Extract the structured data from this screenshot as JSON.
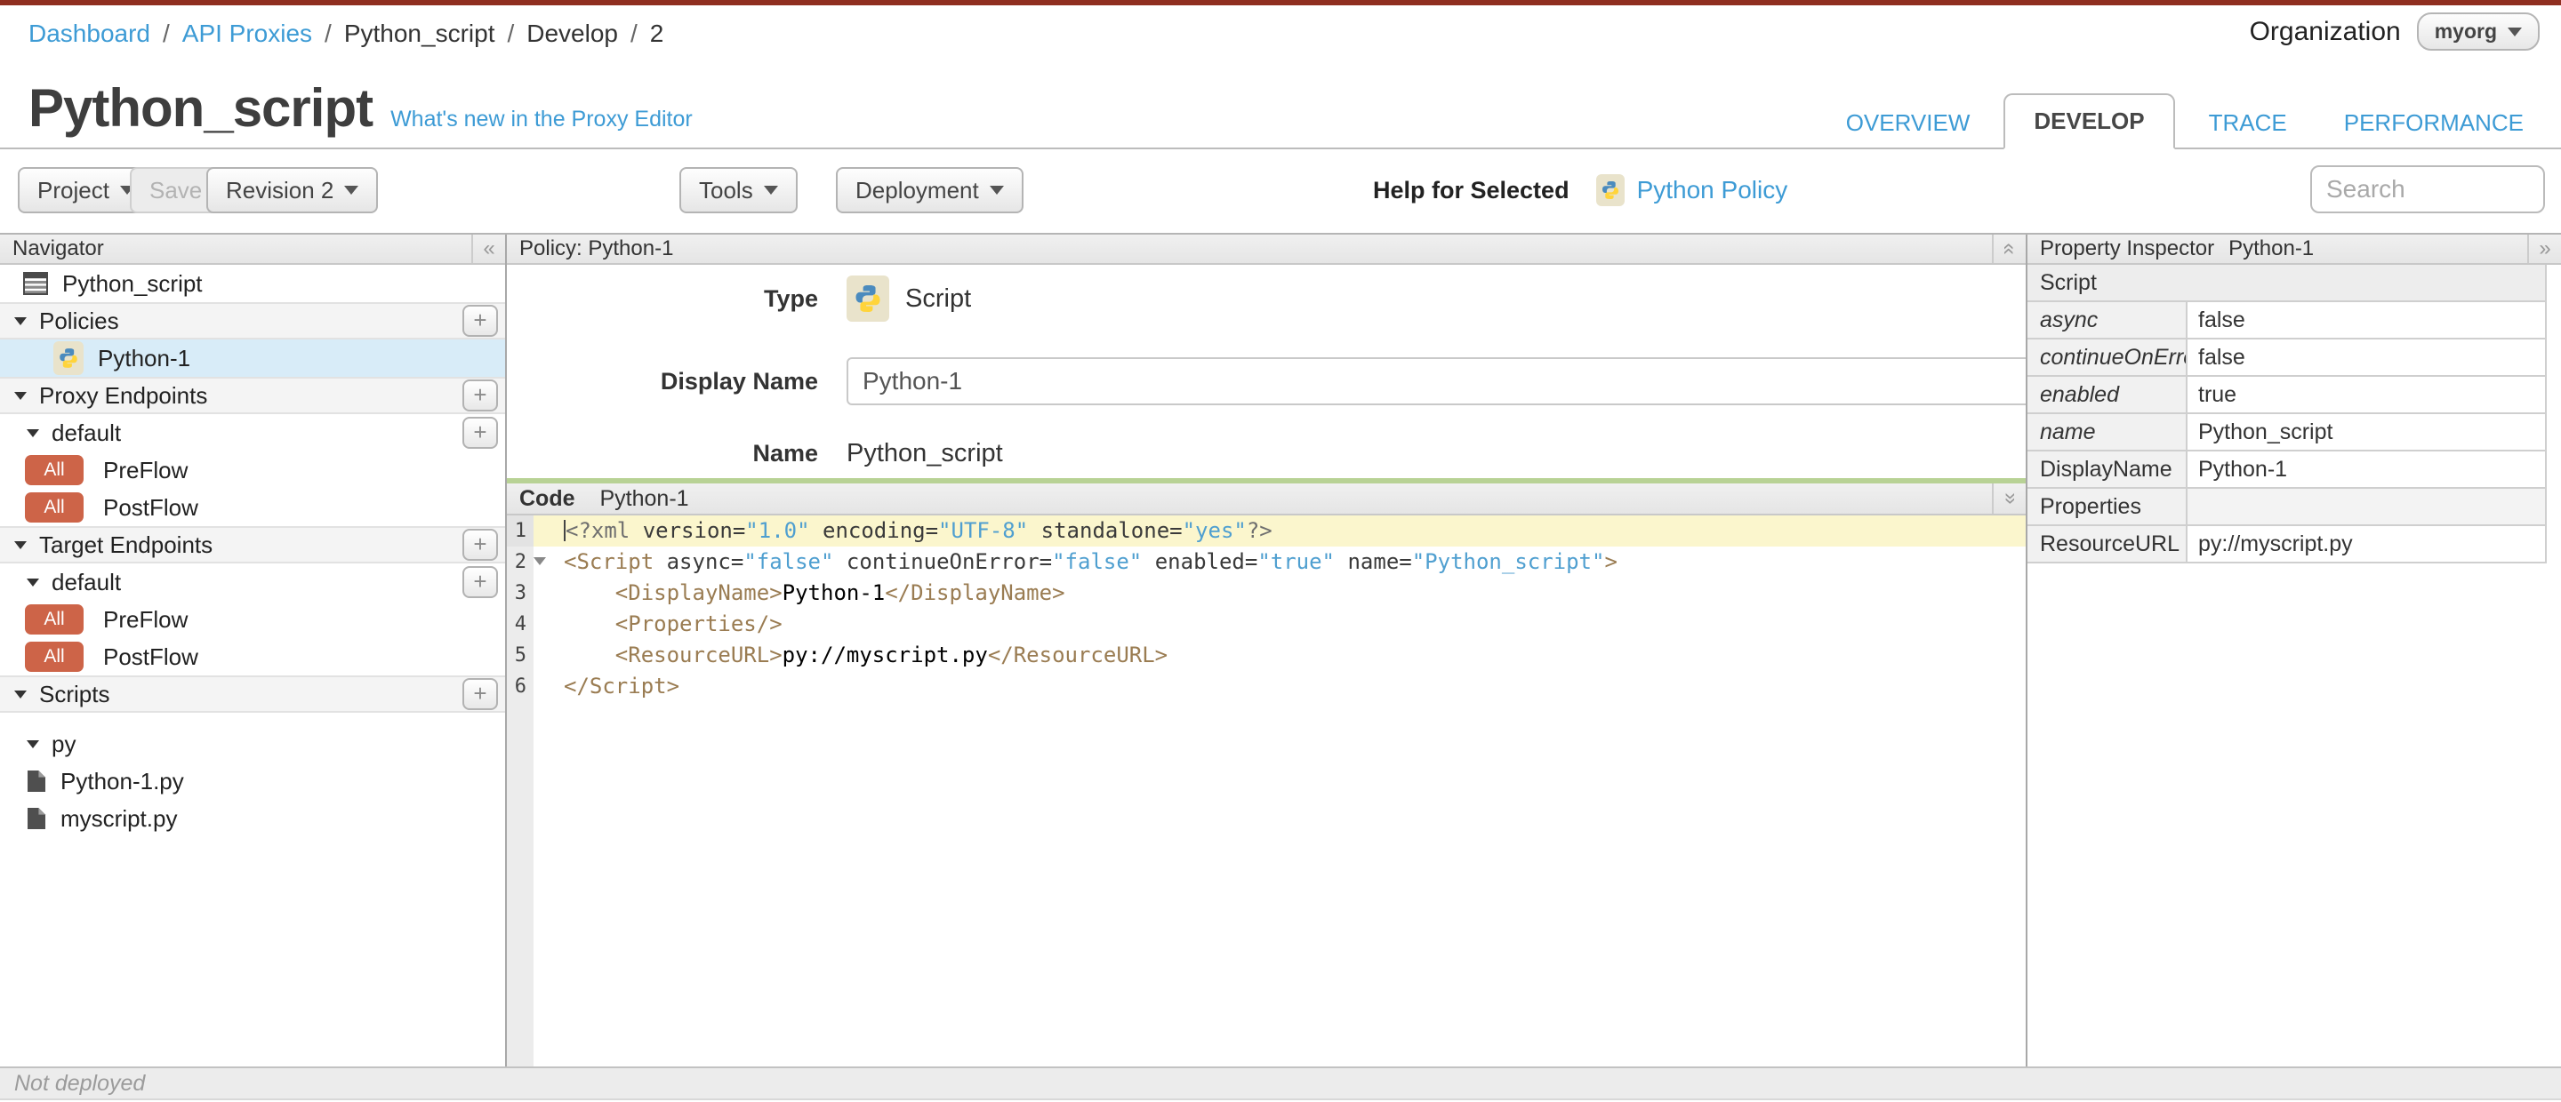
{
  "colors": {
    "topbar_accent": "#8f2e20",
    "link_blue": "#3d9bd5",
    "all_badge": "#cd6448",
    "selected_row": "#d8ecf8",
    "green_divider": "#b8d295",
    "active_code_line": "#fbf6cd",
    "python_icon_bg": "#e9e3cb"
  },
  "icons": [
    "python-icon",
    "proxy-list-icon",
    "file-icon",
    "plus-icon",
    "collapse-left-icon",
    "expand-right-icon",
    "collapse-up-icon",
    "collapse-down-icon",
    "caret-down-icon"
  ],
  "topbar": {
    "breadcrumb": [
      {
        "label": "Dashboard",
        "link": true
      },
      {
        "label": "API Proxies",
        "link": true
      },
      {
        "label": "Python_script",
        "link": false
      },
      {
        "label": "Develop",
        "link": false
      },
      {
        "label": "2",
        "link": false
      }
    ],
    "org_label": "Organization",
    "org_value": "myorg"
  },
  "header": {
    "title": "Python_script",
    "whats_new": "What's new in the Proxy Editor",
    "tabs": [
      {
        "label": "OVERVIEW",
        "active": false
      },
      {
        "label": "DEVELOP",
        "active": true
      },
      {
        "label": "TRACE",
        "active": false
      },
      {
        "label": "PERFORMANCE",
        "active": false
      }
    ]
  },
  "toolbar": {
    "project": "Project",
    "save": "Save",
    "revision": "Revision 2",
    "tools": "Tools",
    "deployment": "Deployment",
    "help_for_selected": "Help for Selected",
    "help_link": "Python Policy",
    "search_placeholder": "Search"
  },
  "navigator": {
    "title": "Navigator",
    "rows": [
      {
        "type": "item",
        "icon": "proxy-list-icon",
        "label": "Python_script"
      },
      {
        "type": "section",
        "label": "Policies",
        "add": true
      },
      {
        "type": "policy",
        "icon": "python-icon",
        "label": "Python-1",
        "selected": true
      },
      {
        "type": "section",
        "label": "Proxy Endpoints",
        "add": true
      },
      {
        "type": "sub",
        "label": "default",
        "add": true
      },
      {
        "type": "flow",
        "badge": "All",
        "label": "PreFlow"
      },
      {
        "type": "flow",
        "badge": "All",
        "label": "PostFlow"
      },
      {
        "type": "section",
        "label": "Target Endpoints",
        "add": true
      },
      {
        "type": "sub",
        "label": "default",
        "add": true
      },
      {
        "type": "flow",
        "badge": "All",
        "label": "PreFlow"
      },
      {
        "type": "flow",
        "badge": "All",
        "label": "PostFlow"
      },
      {
        "type": "section",
        "label": "Scripts",
        "add": true
      },
      {
        "type": "gap"
      },
      {
        "type": "sub",
        "label": "py"
      },
      {
        "type": "file",
        "icon": "file-icon",
        "label": "Python-1.py"
      },
      {
        "type": "file",
        "icon": "file-icon",
        "label": "myscript.py"
      }
    ]
  },
  "policy": {
    "header": "Policy: Python-1",
    "type_label": "Type",
    "type_value": "Script",
    "display_name_label": "Display Name",
    "display_name_value": "Python-1",
    "name_label": "Name",
    "name_value": "Python_script"
  },
  "code": {
    "header_label": "Code",
    "header_value": "Python-1",
    "lines": [
      {
        "n": "1",
        "active": true,
        "tokens": [
          {
            "c": "pi",
            "t": "<?xml"
          },
          {
            "c": "attr",
            "t": " version="
          },
          {
            "c": "str",
            "t": "\"1.0\""
          },
          {
            "c": "attr",
            "t": " encoding="
          },
          {
            "c": "str",
            "t": "\"UTF-8\""
          },
          {
            "c": "attr",
            "t": " standalone="
          },
          {
            "c": "str",
            "t": "\"yes\""
          },
          {
            "c": "pi",
            "t": "?>"
          }
        ]
      },
      {
        "n": "2",
        "fold": true,
        "tokens": [
          {
            "c": "tag",
            "t": "<Script"
          },
          {
            "c": "attr",
            "t": " async="
          },
          {
            "c": "str",
            "t": "\"false\""
          },
          {
            "c": "attr",
            "t": " continueOnError="
          },
          {
            "c": "str",
            "t": "\"false\""
          },
          {
            "c": "attr",
            "t": " enabled="
          },
          {
            "c": "str",
            "t": "\"true\""
          },
          {
            "c": "attr",
            "t": " name="
          },
          {
            "c": "str",
            "t": "\"Python_script\""
          },
          {
            "c": "tag",
            "t": ">"
          }
        ]
      },
      {
        "n": "3",
        "tokens": [
          {
            "c": "plain",
            "t": "    "
          },
          {
            "c": "tag",
            "t": "<DisplayName>"
          },
          {
            "c": "txt",
            "t": "Python-1"
          },
          {
            "c": "tag",
            "t": "</DisplayName>"
          }
        ]
      },
      {
        "n": "4",
        "tokens": [
          {
            "c": "plain",
            "t": "    "
          },
          {
            "c": "tag",
            "t": "<Properties/>"
          }
        ]
      },
      {
        "n": "5",
        "tokens": [
          {
            "c": "plain",
            "t": "    "
          },
          {
            "c": "tag",
            "t": "<ResourceURL>"
          },
          {
            "c": "txt",
            "t": "py://myscript.py"
          },
          {
            "c": "tag",
            "t": "</ResourceURL>"
          }
        ]
      },
      {
        "n": "6",
        "tokens": [
          {
            "c": "tag",
            "t": "</Script>"
          }
        ]
      }
    ]
  },
  "inspector": {
    "title": "Property Inspector",
    "subtitle": "Python-1",
    "rows": [
      {
        "kind": "section",
        "label": "Script",
        "value": ""
      },
      {
        "kind": "attr",
        "label": "async",
        "value": "false"
      },
      {
        "kind": "attr",
        "label": "continueOnError",
        "value": "false"
      },
      {
        "kind": "attr",
        "label": "enabled",
        "value": "true"
      },
      {
        "kind": "attr",
        "label": "name",
        "value": "Python_script"
      },
      {
        "kind": "elem",
        "label": "DisplayName",
        "value": "Python-1"
      },
      {
        "kind": "empty",
        "label": "Properties",
        "value": ""
      },
      {
        "kind": "elem",
        "label": "ResourceURL",
        "value": "py://myscript.py"
      }
    ]
  },
  "statusbar": {
    "text": "Not deployed"
  }
}
